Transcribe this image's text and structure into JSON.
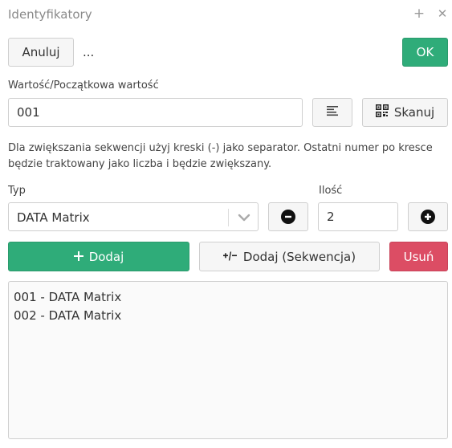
{
  "window": {
    "title": "Identyfikatory"
  },
  "toolbar": {
    "cancel_label": "Anuluj",
    "more_label": "...",
    "ok_label": "OK"
  },
  "value": {
    "label": "Wartość/Początkowa wartość",
    "current": "001",
    "scan_label": "Skanuj"
  },
  "help_text": "Dla zwiększania sekwencji użyj kreski (-) jako separator. Ostatni numer po kresce będzie traktowany jako liczba i będzie zwiększany.",
  "type": {
    "label": "Typ",
    "selected": "DATA Matrix"
  },
  "quantity": {
    "label": "Ilość",
    "value": "2"
  },
  "actions": {
    "add_label": "Dodaj",
    "add_sequence_label": "Dodaj (Sekwencja)",
    "remove_label": "Usuń"
  },
  "items": [
    "001 - DATA Matrix",
    "002 - DATA Matrix"
  ],
  "colors": {
    "primary": "#2fac79",
    "danger": "#dc4d64"
  },
  "icons": [
    "plus-icon",
    "close-icon",
    "format-lines-icon",
    "qr-code-icon",
    "chevron-down-icon",
    "minus-circle-icon",
    "plus-circle-icon",
    "sequence-icon"
  ]
}
